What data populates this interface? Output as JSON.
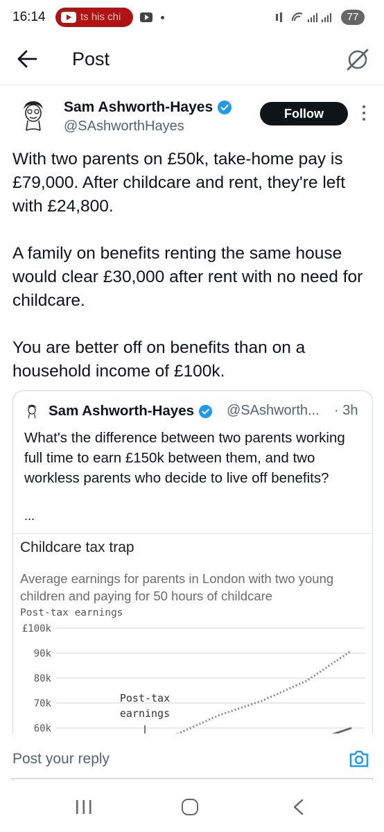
{
  "status_bar": {
    "time": "16:14",
    "youtube_notification_text": "ts his chi",
    "signal_text": "⁙ ▾.… .…",
    "battery": "77"
  },
  "header": {
    "title": "Post"
  },
  "post": {
    "author_name": "Sam Ashworth-Hayes",
    "author_handle": "@SAshworthHayes",
    "follow_label": "Follow",
    "paragraphs": [
      "With two parents on £50k, take-home pay is £79,000. After childcare and rent, they're left with £24,800.",
      "A family on benefits renting the same house would clear £30,000 after rent with no need for childcare.",
      "You are better off on benefits than on a household income of £100k."
    ]
  },
  "quoted_post": {
    "author_name": "Sam Ashworth-Hayes",
    "author_handle": "@SAshworth...",
    "time": "· 3h",
    "text": "What's the difference between two parents working full time to earn £150k between them, and two workless parents who decide to live off benefits?",
    "ellipsis": "..."
  },
  "chart_data": {
    "type": "line",
    "title": "Childcare tax trap",
    "subtitle": "Average earnings for parents in London with two young children and paying for 50 hours of childcare",
    "ylabel": "Post-tax earnings",
    "y_ticks": [
      "£100k",
      "90k",
      "80k",
      "70k",
      "60k"
    ],
    "y_tick_values": [
      100000,
      90000,
      80000,
      70000,
      60000
    ],
    "annotation": "Post-tax earnings",
    "annotation_lines": [
      "Post-tax",
      "earnings"
    ],
    "series": [
      {
        "values": [
          [
            0,
            57000
          ],
          [
            10,
            61000
          ],
          [
            20,
            65000
          ],
          [
            30,
            68000
          ],
          [
            40,
            71000
          ],
          [
            50,
            75000
          ],
          [
            60,
            79000
          ],
          [
            70,
            85000
          ],
          [
            80,
            91000
          ]
        ]
      },
      {
        "values": [
          [
            70,
            57000
          ],
          [
            80,
            60000
          ]
        ]
      }
    ],
    "ylim": [
      56000,
      100000
    ],
    "grid": true,
    "colors": {
      "dotted_series": "#888888",
      "solid_series": "#666666",
      "grid": "#d6d6d6"
    }
  },
  "reply": {
    "placeholder": "Post your reply"
  },
  "colors": {
    "verified_blue": "#1d9bf0",
    "camera_blue": "#1d9bf0",
    "follow_bg": "#0f1419",
    "secondary_text": "#536471"
  },
  "icons": {
    "back": "arrow-left-icon",
    "grok": "grok-icon",
    "more": "more-vertical-icon",
    "verified": "verified-badge-icon",
    "camera": "camera-icon"
  }
}
